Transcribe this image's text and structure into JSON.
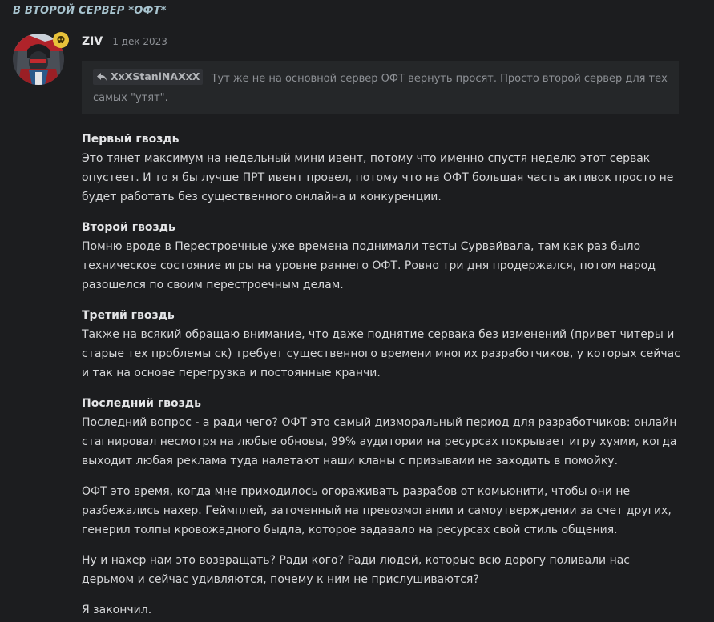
{
  "topic": {
    "title": "В ВТОРОЙ СЕРВЕР *ОФТ*"
  },
  "post": {
    "username": "ZIV",
    "date": "1 дек 2023",
    "quote": {
      "author": "XxXStaniNAXxX",
      "text": "Тут же не на основной сервер ОФТ вернуть просят. Просто второй сервер для тех самых \"утят\"."
    },
    "sections": [
      {
        "heading": "Первый гвоздь",
        "text": "Это тянет максимум на недельный мини ивент, потому что именно спустя неделю этот сервак опустеет. И то я бы лучше ПРТ ивент провел, потому что на ОФТ большая часть активок просто не будет работать без существенного онлайна и конкуренции."
      },
      {
        "heading": "Второй гвоздь",
        "text": "Помню вроде в Перестроечные уже времена поднимали тесты Сурвайвала, там как раз было техническое состояние игры на уровне раннего ОФТ. Ровно три дня продержался, потом народ разошелся по своим перестроечным делам."
      },
      {
        "heading": "Третий гвоздь",
        "text": "Также на всякий обращаю внимание, что даже поднятие сервака без изменений (привет читеры и старые тех проблемы ск) требует существенного времени многих разработчиков, у которых сейчас и так на основе перегрузка и постоянные кранчи."
      },
      {
        "heading": "Последний гвоздь",
        "text": "Последний вопрос - а ради чего? ОФТ это самый дизморальный период для разработчиков: онлайн стагнировал несмотря на любые обновы, 99% аудитории на ресурсах покрывает игру хуями, когда выходит любая реклама туда налетают наши кланы с призывами не заходить в помойку."
      }
    ],
    "paragraphs": [
      "ОФТ это время, когда мне приходилось огораживать разрабов от комьюнити, чтобы они не разбежались нахер. Геймплей, заточенный на превозмогании и самоутверждении за счет других, генерил толпы кровожадного быдла, которое задавало на ресурсах свой стиль общения.",
      "Ну и нахер нам это возвращать? Ради кого? Ради людей, которые всю дорогу поливали нас дерьмом и сейчас удивляются, почему к ним не прислушиваются?",
      "Я закончил."
    ]
  },
  "icons": {
    "avatar": "avatar-image",
    "flair": "skull-icon",
    "quote_reply": "reply-arrow-icon"
  },
  "colors": {
    "background": "#1c1d1f",
    "title": "#a8c4cf",
    "flair": "#e8c23a",
    "quote_bg": "#252729"
  }
}
